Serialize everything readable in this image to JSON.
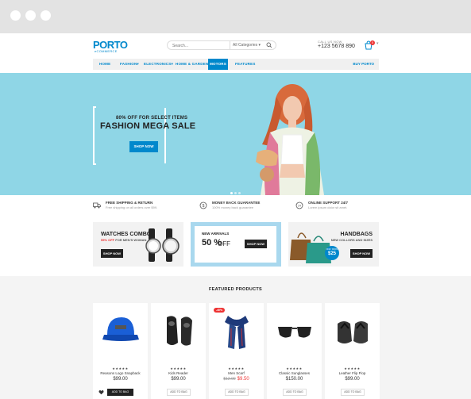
{
  "logo": {
    "name": "PORTO",
    "tagline": "eCOMMERCE"
  },
  "search": {
    "placeholder": "Search...",
    "category": "All Categories"
  },
  "contact": {
    "label": "CALL US NOW",
    "phone": "+123 5678 890"
  },
  "cart": {
    "count": "0"
  },
  "nav": {
    "items": [
      "HOME",
      "FASHION",
      "ELECTRONICS",
      "HOME & GARDEN",
      "MOTORS",
      "FEATURES"
    ],
    "active": "MOTORS",
    "right": "BUY PORTO"
  },
  "hero": {
    "pretitle": "80% OFF FOR SELECT ITEMS",
    "title": "FASHION MEGA SALE",
    "button": "SHOP NOW",
    "background": "#8fd6e6"
  },
  "features": [
    {
      "icon": "truck-icon",
      "title": "FREE SHIPPING & RETURN",
      "subtitle": "Free shipping on all orders over $99."
    },
    {
      "icon": "money-icon",
      "title": "MONEY BACK GUARANTEE",
      "subtitle": "100% money back guarantee"
    },
    {
      "icon": "support-icon",
      "title": "ONLINE SUPPORT 24/7",
      "subtitle": "Lorem ipsum dolor sit amet."
    }
  ],
  "banners": {
    "watches": {
      "title": "WATCHES COMBO",
      "discount": "55% OFF",
      "discount_suffix": "FOR MEN'S WOMAN",
      "button": "SHOP NOW"
    },
    "arrivals": {
      "pretitle": "NEW ARRIVALS",
      "percent": "50 %",
      "off": "OFF",
      "button": "SHOP NOW"
    },
    "handbags": {
      "title": "HANDBAGS",
      "subtitle": "NEW COLLORS AND SIZES",
      "badge_top": "ONLY FROM",
      "badge_price": "$25",
      "button": "SHOP NOW"
    }
  },
  "featured": {
    "title": "FEATURED PRODUCTS",
    "products": [
      {
        "name": "Reasons Logo Snapback",
        "price": "$99.00",
        "old_price": "",
        "button": "ADD TO BAG",
        "sale": "",
        "rating": "★★★★★"
      },
      {
        "name": "Kids Reader",
        "price": "$99.00",
        "old_price": "",
        "button": "ADD TO BAG",
        "sale": "",
        "rating": "★★★★★"
      },
      {
        "name": "Men Scarf",
        "price": "$9.50",
        "old_price": "$12.00",
        "button": "ADD TO BAG",
        "sale": "-40%",
        "rating": "★★★★★"
      },
      {
        "name": "Classic Sunglasses",
        "price": "$150.00",
        "old_price": "",
        "button": "ADD TO BAG",
        "sale": "",
        "rating": "★★★★★"
      },
      {
        "name": "Leather Flip Flop",
        "price": "$99.00",
        "old_price": "",
        "button": "ADD TO BAG",
        "sale": "",
        "rating": "★★★★★"
      }
    ]
  },
  "colors": {
    "accent": "#0088cc",
    "sale": "#ee3333",
    "dark": "#222222"
  }
}
